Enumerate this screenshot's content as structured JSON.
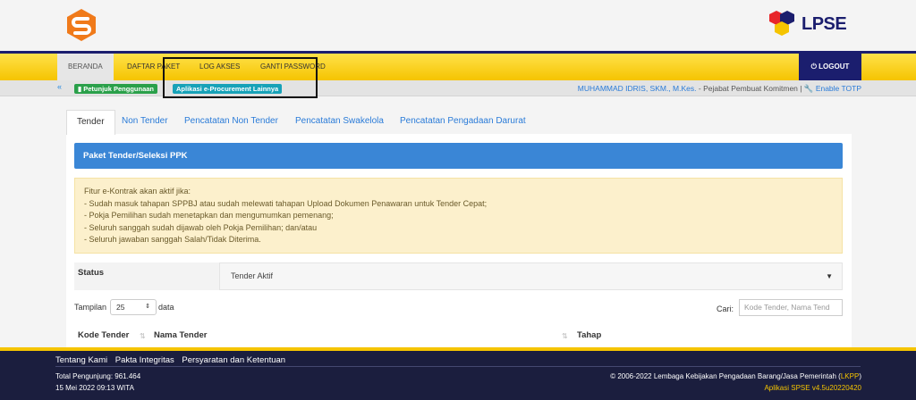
{
  "nav": {
    "items": [
      "BERANDA",
      "DAFTAR PAKET",
      "LOG AKSES",
      "GANTI PASSWORD"
    ],
    "logout_label": "LOGOUT"
  },
  "brand": {
    "right_logo_text": "LPSE"
  },
  "subbar": {
    "guide_label": "Petunjuk Penggunaan",
    "other_apps_label": "Aplikasi e-Procurement Lainnya",
    "user_name": "MUHAMMAD IDRIS, SKM., M.Kes.",
    "user_role": " - Pejabat Pembuat Komitmen | ",
    "totp_label": "Enable TOTP"
  },
  "tabs": [
    "Tender",
    "Non Tender",
    "Pencatatan Non Tender",
    "Pencatatan Swakelola",
    "Pencatatan Pengadaan Darurat"
  ],
  "panel": {
    "title": "Paket Tender/Seleksi PPK"
  },
  "alert": {
    "lines": [
      "Fitur e-Kontrak akan aktif jika:",
      "- Sudah masuk tahapan SPPBJ atau sudah melewati tahapan Upload Dokumen Penawaran untuk Tender Cepat;",
      "- Pokja Pemilihan sudah menetapkan dan mengumumkan pemenang;",
      "- Seluruh sanggah sudah dijawab oleh Pokja Pemilihan; dan/atau",
      "- Seluruh jawaban sanggah Salah/Tidak Diterima."
    ]
  },
  "filter": {
    "status_label": "Status",
    "status_value": "Tender Aktif",
    "show_label": "Tampilan",
    "page_size": "25",
    "data_label": "data",
    "search_label": "Cari:",
    "search_placeholder": "Kode Tender, Nama Tend"
  },
  "table": {
    "headers": [
      "Kode Tender",
      "Nama Tender",
      "Tahap"
    ]
  },
  "footer": {
    "links": [
      "Tentang Kami",
      "Pakta Integritas",
      "Persyaratan dan Ketentuan"
    ],
    "visitors": "Total Pengunjung: 961.464",
    "datetime": "15 Mei 2022 09:13 WITA",
    "copyright_pre": "© 2006-2022 Lembaga Kebijakan Pengadaan Barang/Jasa Pemerintah (",
    "copyright_link": "LKPP",
    "copyright_post": ")",
    "version": "Aplikasi SPSE v4.5u20220420"
  },
  "colors": {
    "navy": "#1b1e6e",
    "yellow": "#f5c400",
    "blue": "#3a86d6",
    "alert_bg": "#fcf0cc"
  }
}
